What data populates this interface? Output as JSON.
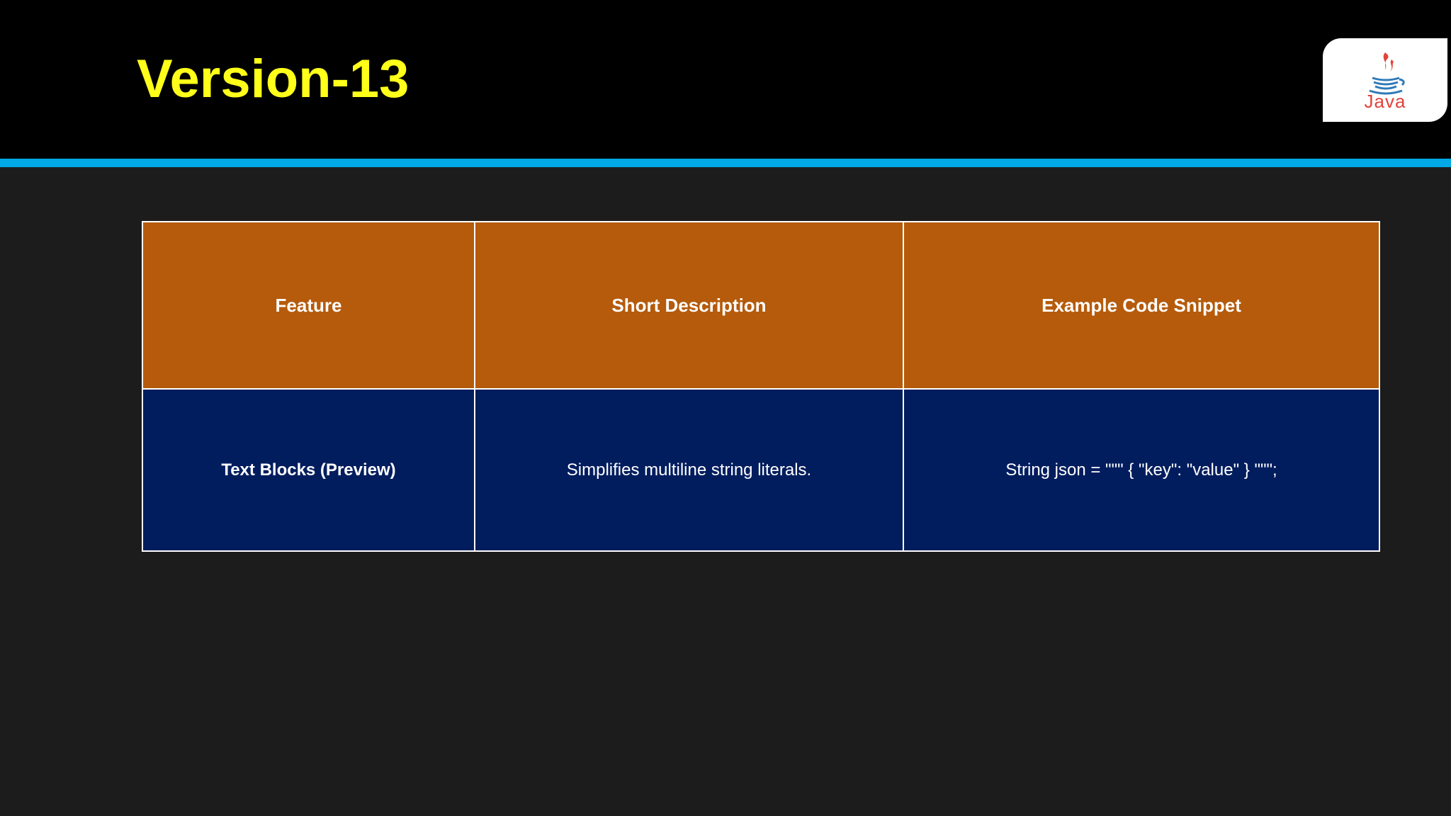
{
  "slide": {
    "title": "Version-13",
    "logo": {
      "label": "Java",
      "icon": "java-coffee-cup-icon"
    }
  },
  "table": {
    "headers": [
      "Feature",
      "Short Description",
      "Example Code Snippet"
    ],
    "rows": [
      {
        "feature": "Text Blocks (Preview)",
        "description": "Simplifies multiline string literals.",
        "code": "String json = \"\"\" { \"key\": \"value\" } \"\"\";"
      }
    ]
  },
  "colors": {
    "title": "#ffff1a",
    "header_bar": "#000000",
    "accent_line": "#00a9e6",
    "background": "#1c1c1c",
    "table_header_bg": "#b55b0b",
    "table_row_bg": "#021d5e",
    "table_border": "#ffffff",
    "logo_red": "#e2423a",
    "logo_blue": "#2f7ab8"
  }
}
